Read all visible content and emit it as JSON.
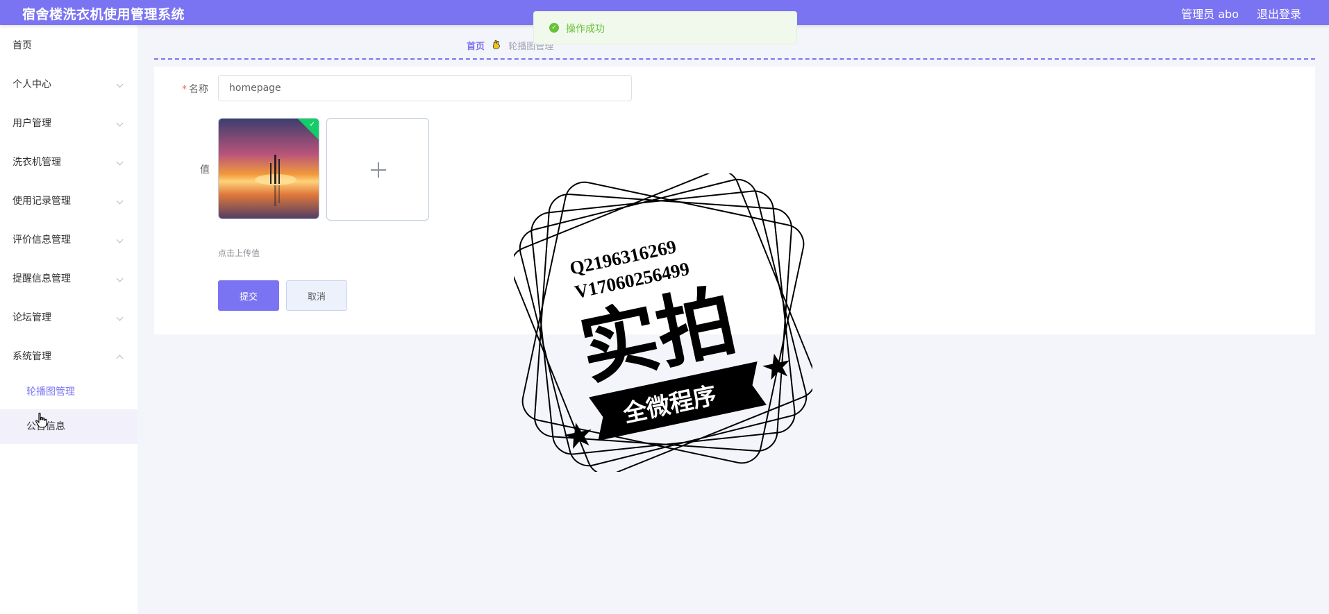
{
  "header": {
    "title": "宿舍楼洗衣机使用管理系统",
    "admin": "管理员 abo",
    "logout": "退出登录"
  },
  "sidebar": {
    "items": [
      {
        "label": "首页",
        "has_arrow": false
      },
      {
        "label": "个人中心",
        "has_arrow": true
      },
      {
        "label": "用户管理",
        "has_arrow": true
      },
      {
        "label": "洗衣机管理",
        "has_arrow": true
      },
      {
        "label": "使用记录管理",
        "has_arrow": true
      },
      {
        "label": "评价信息管理",
        "has_arrow": true
      },
      {
        "label": "提醒信息管理",
        "has_arrow": true
      },
      {
        "label": "论坛管理",
        "has_arrow": true
      },
      {
        "label": "系统管理",
        "has_arrow": true,
        "expanded": true
      }
    ],
    "submenu": [
      {
        "label": "轮播图管理",
        "active": true
      },
      {
        "label": "公告信息",
        "hovered": true
      }
    ]
  },
  "breadcrumb": {
    "home": "首页",
    "current": "轮播图管理"
  },
  "form": {
    "name_label": "名称",
    "name_value": "homepage",
    "value_label": "值",
    "upload_hint": "点击上传值",
    "submit": "提交",
    "cancel": "取消"
  },
  "toast": {
    "message": "操作成功"
  },
  "watermark": {
    "line1": "Q2196316269",
    "line2": "V17060256499",
    "main": "实拍",
    "banner": "全微程序"
  },
  "colors": {
    "primary": "#7b74f2",
    "success": "#67c23a",
    "background": "#f4f5fa"
  }
}
